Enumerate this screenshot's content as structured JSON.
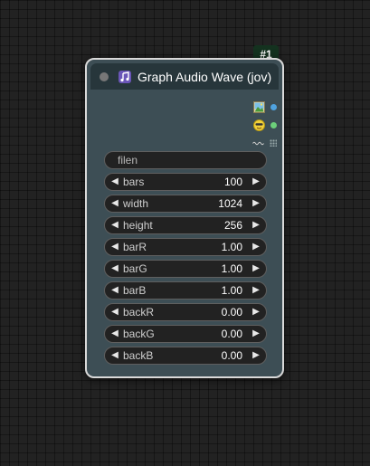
{
  "node": {
    "id_badge": "#1",
    "title": "Graph Audio Wave (jov)",
    "title_icon": "music-note-icon",
    "collapse_icon": "collapse-dot-icon"
  },
  "outputs": [
    {
      "icon": "image-icon",
      "slot_color": "#4fa3e0"
    },
    {
      "icon": "mask-face-icon",
      "slot_color": "#6ccf7a"
    },
    {
      "icon": "wave-icon",
      "slot": "grid"
    }
  ],
  "widgets": {
    "filen": {
      "placeholder": "filen"
    },
    "items": [
      {
        "label": "bars",
        "value": "100"
      },
      {
        "label": "width",
        "value": "1024"
      },
      {
        "label": "height",
        "value": "256"
      },
      {
        "label": "barR",
        "value": "1.00"
      },
      {
        "label": "barG",
        "value": "1.00"
      },
      {
        "label": "barB",
        "value": "1.00"
      },
      {
        "label": "backR",
        "value": "0.00"
      },
      {
        "label": "backG",
        "value": "0.00"
      },
      {
        "label": "backB",
        "value": "0.00"
      }
    ],
    "arrow_left": "◀",
    "arrow_right": "▶"
  }
}
